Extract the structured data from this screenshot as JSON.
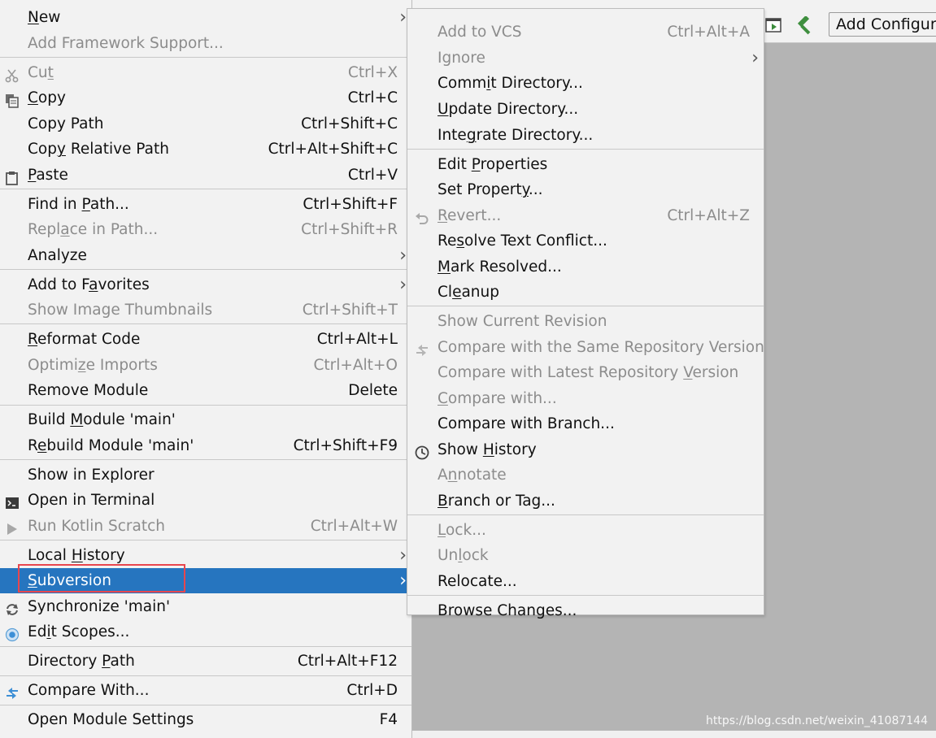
{
  "toolbar": {
    "add_configuration_label": "Add Configura"
  },
  "watermark": "https://blog.csdn.net/weixin_41087144",
  "main_menu": {
    "items": [
      {
        "label": "New",
        "pre": "",
        "ul": "N",
        "post": "ew",
        "shortcut": "",
        "submenu": true,
        "disabled": false
      },
      {
        "label": "Add Framework Support...",
        "pre": "Add Framework Support...",
        "ul": "",
        "post": "",
        "shortcut": "",
        "submenu": false,
        "disabled": true
      },
      {
        "label": "Cut",
        "pre": "Cu",
        "ul": "t",
        "post": "",
        "shortcut": "Ctrl+X",
        "icon": "scissors-icon",
        "disabled": true
      },
      {
        "label": "Copy",
        "pre": "",
        "ul": "C",
        "post": "opy",
        "shortcut": "Ctrl+C",
        "icon": "copy-icon",
        "disabled": false
      },
      {
        "label": "Copy Path",
        "pre": "Copy Path",
        "ul": "",
        "post": "",
        "shortcut": "Ctrl+Shift+C",
        "disabled": false
      },
      {
        "label": "Copy Relative Path",
        "pre": "Cop",
        "ul": "y",
        "post": " Relative Path",
        "shortcut": "Ctrl+Alt+Shift+C",
        "disabled": false
      },
      {
        "label": "Paste",
        "pre": "",
        "ul": "P",
        "post": "aste",
        "shortcut": "Ctrl+V",
        "icon": "paste-icon",
        "disabled": false
      },
      {
        "label": "Find in Path...",
        "pre": "Find in ",
        "ul": "P",
        "post": "ath...",
        "shortcut": "Ctrl+Shift+F",
        "disabled": false
      },
      {
        "label": "Replace in Path...",
        "pre": "Repl",
        "ul": "a",
        "post": "ce in Path...",
        "shortcut": "Ctrl+Shift+R",
        "disabled": true
      },
      {
        "label": "Analyze",
        "pre": "Analyze",
        "ul": "",
        "post": "",
        "shortcut": "",
        "submenu": true,
        "disabled": false
      },
      {
        "label": "Add to Favorites",
        "pre": "Add to F",
        "ul": "a",
        "post": "vorites",
        "shortcut": "",
        "submenu": true,
        "disabled": false
      },
      {
        "label": "Show Image Thumbnails",
        "pre": "Show Image Thumbnails",
        "ul": "",
        "post": "",
        "shortcut": "Ctrl+Shift+T",
        "disabled": true
      },
      {
        "label": "Reformat Code",
        "pre": "",
        "ul": "R",
        "post": "eformat Code",
        "shortcut": "Ctrl+Alt+L",
        "disabled": false
      },
      {
        "label": "Optimize Imports",
        "pre": "Optimi",
        "ul": "z",
        "post": "e Imports",
        "shortcut": "Ctrl+Alt+O",
        "disabled": true
      },
      {
        "label": "Remove Module",
        "pre": "Remove Module",
        "ul": "",
        "post": "",
        "shortcut": "Delete",
        "disabled": false
      },
      {
        "label": "Build Module 'main'",
        "pre": "Build ",
        "ul": "M",
        "post": "odule 'main'",
        "shortcut": "",
        "disabled": false
      },
      {
        "label": "Rebuild Module 'main'",
        "pre": "R",
        "ul": "e",
        "post": "build Module 'main'",
        "shortcut": "Ctrl+Shift+F9",
        "disabled": false
      },
      {
        "label": "Show in Explorer",
        "pre": "Show in Explorer",
        "ul": "",
        "post": "",
        "shortcut": "",
        "disabled": false
      },
      {
        "label": "Open in Terminal",
        "pre": "Open in Terminal",
        "ul": "",
        "post": "",
        "shortcut": "",
        "icon": "terminal-icon",
        "disabled": false
      },
      {
        "label": "Run Kotlin Scratch",
        "pre": "Run Kotlin Scratch",
        "ul": "",
        "post": "",
        "shortcut": "Ctrl+Alt+W",
        "icon": "run-icon",
        "disabled": true
      },
      {
        "label": "Local History",
        "pre": "Local ",
        "ul": "H",
        "post": "istory",
        "shortcut": "",
        "submenu": true,
        "disabled": false
      },
      {
        "label": "Subversion",
        "pre": "",
        "ul": "S",
        "post": "ubversion",
        "shortcut": "",
        "submenu": true,
        "selected": true,
        "disabled": false
      },
      {
        "label": "Synchronize 'main'",
        "pre": "Synchronize 'main'",
        "ul": "",
        "post": "",
        "shortcut": "",
        "icon": "sync-icon",
        "disabled": false
      },
      {
        "label": "Edit Scopes...",
        "pre": "Ed",
        "ul": "i",
        "post": "t Scopes...",
        "shortcut": "",
        "icon": "scope-icon",
        "disabled": false
      },
      {
        "label": "Directory Path",
        "pre": "Directory ",
        "ul": "P",
        "post": "ath",
        "shortcut": "Ctrl+Alt+F12",
        "disabled": false
      },
      {
        "label": "Compare With...",
        "pre": "Compare With...",
        "ul": "",
        "post": "",
        "shortcut": "Ctrl+D",
        "icon": "compare-icon",
        "disabled": false
      },
      {
        "label": "Open Module Settings",
        "pre": "Open Module Settings",
        "ul": "",
        "post": "",
        "shortcut": "F4",
        "disabled": false
      }
    ]
  },
  "sub_menu": {
    "items": [
      {
        "label": "Add to VCS",
        "pre": "Add to VCS",
        "ul": "",
        "post": "",
        "shortcut": "Ctrl+Alt+A",
        "disabled": true
      },
      {
        "label": "Ignore",
        "pre": "Ignore",
        "ul": "",
        "post": "",
        "shortcut": "",
        "submenu": true,
        "disabled": true
      },
      {
        "label": "Commit Directory...",
        "pre": "Comm",
        "ul": "i",
        "post": "t Directory...",
        "shortcut": "",
        "disabled": false
      },
      {
        "label": "Update Directory...",
        "pre": "",
        "ul": "U",
        "post": "pdate Directory...",
        "shortcut": "",
        "disabled": false
      },
      {
        "label": "Integrate Directory...",
        "pre": "Inte",
        "ul": "g",
        "post": "rate Directory...",
        "shortcut": "",
        "disabled": false
      },
      {
        "label": "Edit Properties",
        "pre": "Edit ",
        "ul": "P",
        "post": "roperties",
        "shortcut": "",
        "disabled": false
      },
      {
        "label": "Set Property...",
        "pre": "Set Propert",
        "ul": "y",
        "post": "...",
        "shortcut": "",
        "disabled": false
      },
      {
        "label": "Revert...",
        "pre": "",
        "ul": "R",
        "post": "evert...",
        "shortcut": "Ctrl+Alt+Z",
        "icon": "revert-icon",
        "disabled": true
      },
      {
        "label": "Resolve Text Conflict...",
        "pre": "Re",
        "ul": "s",
        "post": "olve Text Conflict...",
        "shortcut": "",
        "disabled": false
      },
      {
        "label": "Mark Resolved...",
        "pre": "",
        "ul": "M",
        "post": "ark Resolved...",
        "shortcut": "",
        "disabled": false
      },
      {
        "label": "Cleanup",
        "pre": "Cl",
        "ul": "e",
        "post": "anup",
        "shortcut": "",
        "disabled": false
      },
      {
        "label": "Show Current Revision",
        "pre": "Show Current Revision",
        "ul": "",
        "post": "",
        "shortcut": "",
        "disabled": true
      },
      {
        "label": "Compare with the Same Repository Version",
        "pre": "Compare with the Same Repository Version",
        "ul": "",
        "post": "",
        "shortcut": "",
        "icon": "compare-icon",
        "disabled": true
      },
      {
        "label": "Compare with Latest Repository Version",
        "pre": "Compare with Latest Repository ",
        "ul": "V",
        "post": "ersion",
        "shortcut": "",
        "disabled": true
      },
      {
        "label": "Compare with...",
        "pre": "",
        "ul": "C",
        "post": "ompare with...",
        "shortcut": "",
        "disabled": true
      },
      {
        "label": "Compare with Branch...",
        "pre": "Compare with Branch...",
        "ul": "",
        "post": "",
        "shortcut": "",
        "disabled": false
      },
      {
        "label": "Show History",
        "pre": "Show ",
        "ul": "H",
        "post": "istory",
        "shortcut": "",
        "icon": "history-icon",
        "disabled": false
      },
      {
        "label": "Annotate",
        "pre": "A",
        "ul": "n",
        "post": "notate",
        "shortcut": "",
        "disabled": true
      },
      {
        "label": "Branch or Tag...",
        "pre": "",
        "ul": "B",
        "post": "ranch or Tag...",
        "shortcut": "",
        "disabled": false
      },
      {
        "label": "Lock...",
        "pre": "",
        "ul": "L",
        "post": "ock...",
        "shortcut": "",
        "disabled": true
      },
      {
        "label": "Unlock",
        "pre": "Un",
        "ul": "l",
        "post": "ock",
        "shortcut": "",
        "disabled": true
      },
      {
        "label": "Relocate...",
        "pre": "Relocate...",
        "ul": "",
        "post": "",
        "shortcut": "",
        "disabled": false
      },
      {
        "label": "Browse Changes...",
        "pre": "Browse Changes...",
        "ul": "",
        "post": "",
        "shortcut": "",
        "disabled": false
      }
    ]
  },
  "colors": {
    "menu_bg": "#f2f2f2",
    "selection": "#2675bf",
    "disabled_text": "#8c8c8c",
    "highlight_box": "#e8464e",
    "editor_bg": "#b4b4b4"
  }
}
